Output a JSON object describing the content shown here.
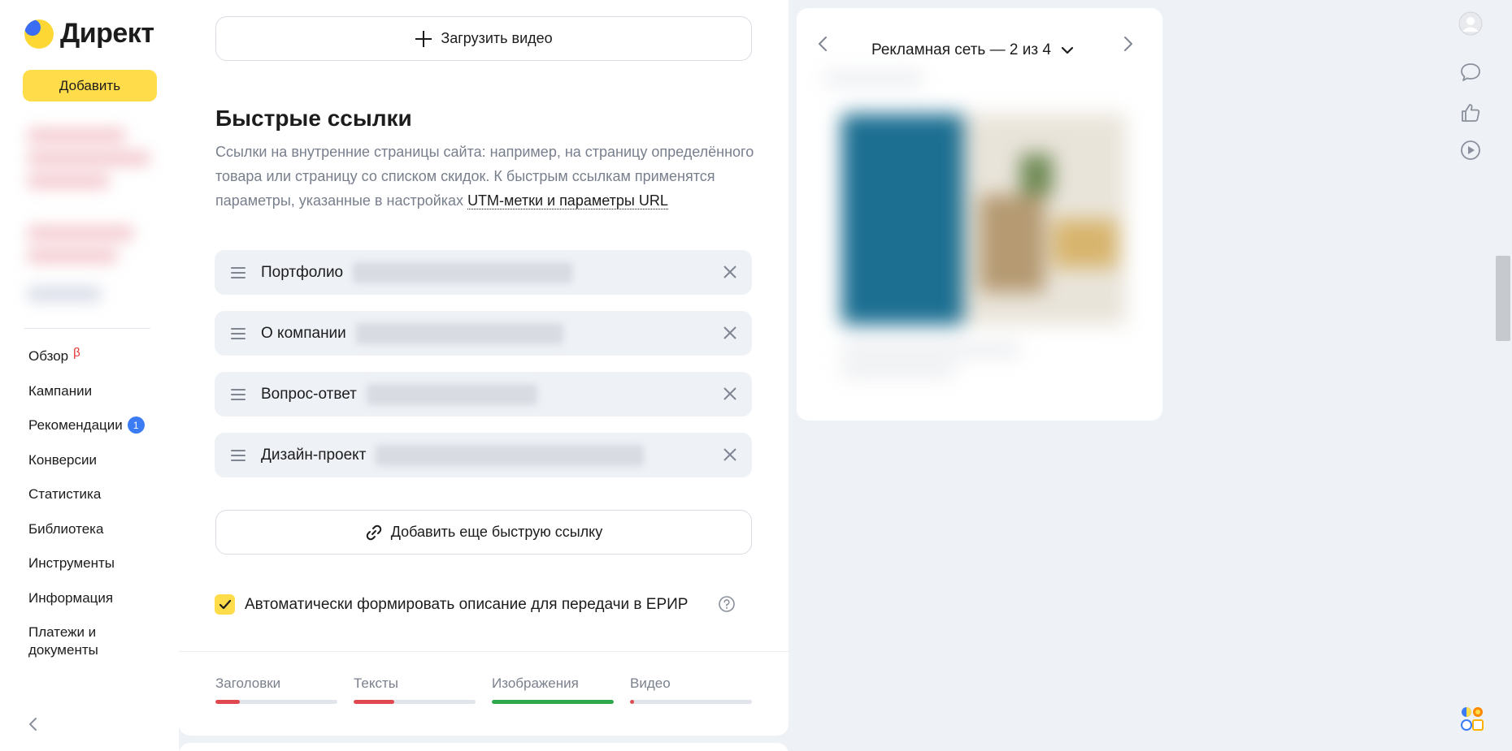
{
  "app": {
    "logo_text": "Директ",
    "add_button": "Добавить"
  },
  "sidebar": {
    "items": [
      {
        "label": "Обзор",
        "badge": "β"
      },
      {
        "label": "Кампании"
      },
      {
        "label": "Рекомендации",
        "count": "1"
      },
      {
        "label": "Конверсии"
      },
      {
        "label": "Статистика"
      },
      {
        "label": "Библиотека"
      },
      {
        "label": "Инструменты"
      },
      {
        "label": "Информация"
      },
      {
        "label": "Платежи и документы"
      }
    ],
    "collapse_icon": "chevron-left-icon"
  },
  "editor": {
    "upload_video": "Загрузить видео",
    "quick_links": {
      "title": "Быстрые ссылки",
      "desc_start": "Ссылки на внутренние страницы сайта: например, на страницу определённого товара или страницу со списком скидок. К быстрым ссылкам применятся параметры, указанные в настройках ",
      "desc_link": "UTM-метки и параметры URL",
      "items": [
        {
          "label": "Портфолио"
        },
        {
          "label": "О компании"
        },
        {
          "label": "Вопрос-ответ"
        },
        {
          "label": "Дизайн-проект"
        }
      ],
      "add_link": "Добавить еще быструю ссылку"
    },
    "erip_checkbox": {
      "label": "Автоматически формировать описание для передачи в ЕРИР",
      "checked": true
    },
    "progress": [
      {
        "label": "Заголовки",
        "value": 0.2,
        "color": "#e0484f"
      },
      {
        "label": "Тексты",
        "value": 0.33,
        "color": "#e0484f"
      },
      {
        "label": "Изображения",
        "value": 1.0,
        "color": "#2ea84a"
      },
      {
        "label": "Видео",
        "value": 0.03,
        "color": "#e0484f"
      }
    ]
  },
  "preview": {
    "title": "Рекламная сеть — 2 из 4",
    "prev_icon": "chevron-left-icon",
    "next_icon": "chevron-right-icon"
  },
  "colors": {
    "accent": "#ffdc4a",
    "badge_blue": "#3b7cf5",
    "beta_red": "#e23030"
  }
}
